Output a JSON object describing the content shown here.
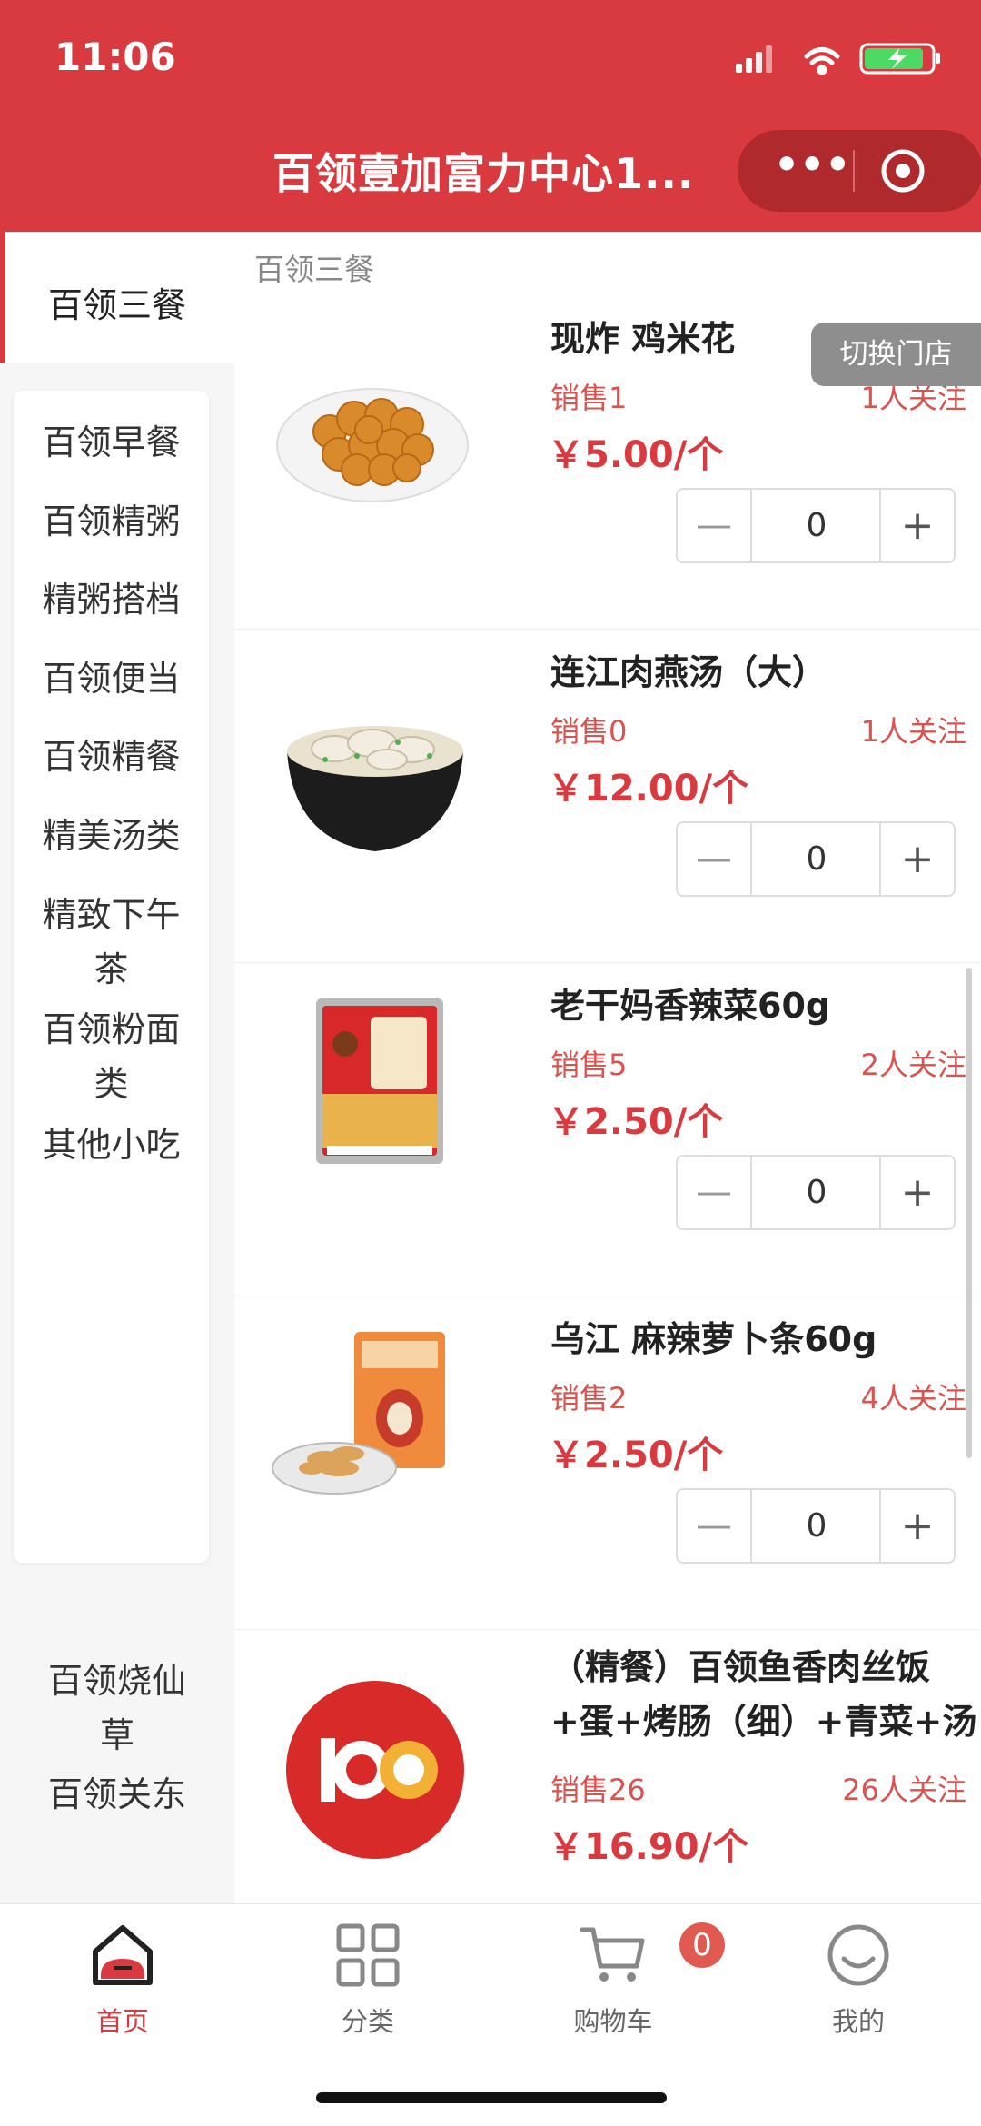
{
  "status": {
    "time": "11:06"
  },
  "header": {
    "title": "百领壹加富力中心1...",
    "more_icon": "more-dots-icon",
    "close_icon": "target-circle-icon",
    "bg_color": "#d93a3f"
  },
  "sidebar": {
    "active": "百领三餐",
    "submenu": [
      "百领早餐",
      "百领精粥",
      "精粥搭档",
      "百领便当",
      "百领精餐",
      "精美汤类",
      "精致下午\n茶",
      "百领粉面\n类",
      "其他小吃"
    ],
    "more": [
      "百领烧仙\n草",
      "百领关东"
    ]
  },
  "section_label": "百领三餐",
  "switch_store": "切换门店",
  "products": [
    {
      "name": "现炸 鸡米花",
      "sales": "销售1",
      "follow": "1人关注",
      "price": "￥5.00/个",
      "qty": "0",
      "image": "popcorn-chicken"
    },
    {
      "name": "连江肉燕汤（大）",
      "sales": "销售0",
      "follow": "1人关注",
      "price": "￥12.00/个",
      "qty": "0",
      "image": "wonton-soup"
    },
    {
      "name": "老干妈香辣菜60g",
      "sales": "销售5",
      "follow": "2人关注",
      "price": "￥2.50/个",
      "qty": "0",
      "image": "spicy-vegetable-pack"
    },
    {
      "name": "乌江 麻辣萝卜条60g",
      "sales": "销售2",
      "follow": "4人关注",
      "price": "￥2.50/个",
      "qty": "0",
      "image": "radish-strips-pack"
    },
    {
      "name": "（精餐）百领鱼香肉丝饭\n+蛋+烤肠（细）+青菜+汤",
      "sales": "销售26",
      "follow": "26人关注",
      "price": "￥16.90/个",
      "image": "brand-logo-100"
    }
  ],
  "stepper": {
    "minus": "—",
    "plus": "+"
  },
  "tabbar": {
    "items": [
      {
        "label": "首页",
        "icon": "home-icon"
      },
      {
        "label": "分类",
        "icon": "grid-icon"
      },
      {
        "label": "购物车",
        "icon": "cart-icon"
      },
      {
        "label": "我的",
        "icon": "smile-icon"
      }
    ],
    "cart_badge": "0"
  },
  "colors": {
    "accent": "#d93a3f",
    "price": "#d93a3f",
    "sales": "#d9534f"
  }
}
